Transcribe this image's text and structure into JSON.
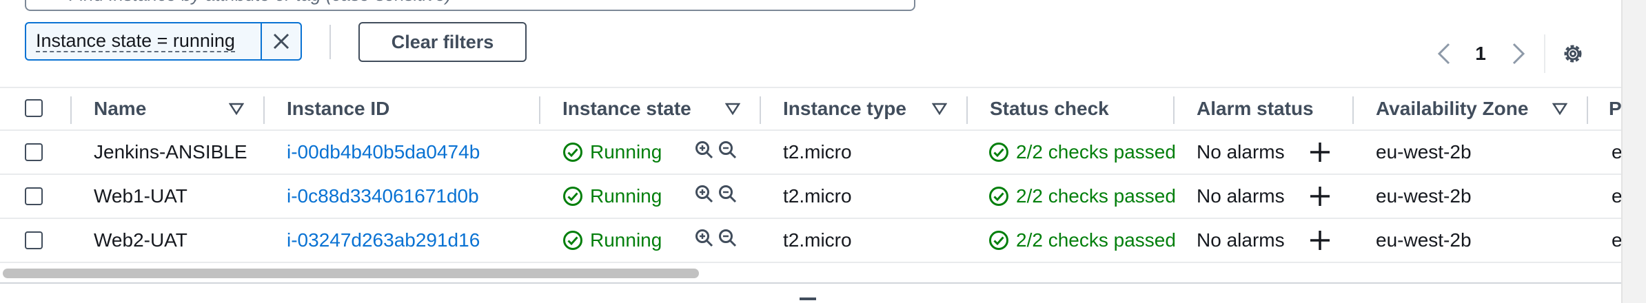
{
  "search": {
    "placeholder": "Find Instance by attribute or tag (case-sensitive)"
  },
  "filter": {
    "token_label": "Instance state = running",
    "clear_label": "Clear filters"
  },
  "pagination": {
    "current_page": "1"
  },
  "table": {
    "columns": [
      {
        "label": "Name"
      },
      {
        "label": "Instance ID"
      },
      {
        "label": "Instance state"
      },
      {
        "label": "Instance type"
      },
      {
        "label": "Status check"
      },
      {
        "label": "Alarm status"
      },
      {
        "label": "Availability Zone"
      },
      {
        "label": "P"
      }
    ],
    "rows": [
      {
        "name": "Jenkins-ANSIBLE",
        "id": "i-00db4b40b5da0474b",
        "state": "Running",
        "type": "t2.micro",
        "status": "2/2 checks passed",
        "alarm": "No alarms",
        "az": "eu-west-2b",
        "extra": "e"
      },
      {
        "name": "Web1-UAT",
        "id": "i-0c88d334061671d0b",
        "state": "Running",
        "type": "t2.micro",
        "status": "2/2 checks passed",
        "alarm": "No alarms",
        "az": "eu-west-2b",
        "extra": "e"
      },
      {
        "name": "Web2-UAT",
        "id": "i-03247d263ab291d16",
        "state": "Running",
        "type": "t2.micro",
        "status": "2/2 checks passed",
        "alarm": "No alarms",
        "az": "eu-west-2b",
        "extra": "e"
      }
    ]
  },
  "colors": {
    "link": "#0972d3",
    "success": "#037f0c",
    "header_text": "#414d5c"
  },
  "icons": [
    "search-icon",
    "close-icon",
    "chevron-left-icon",
    "chevron-right-icon",
    "settings-icon",
    "sort-caret-icon",
    "status-check-icon",
    "zoom-in-icon",
    "zoom-out-icon",
    "plus-icon"
  ]
}
